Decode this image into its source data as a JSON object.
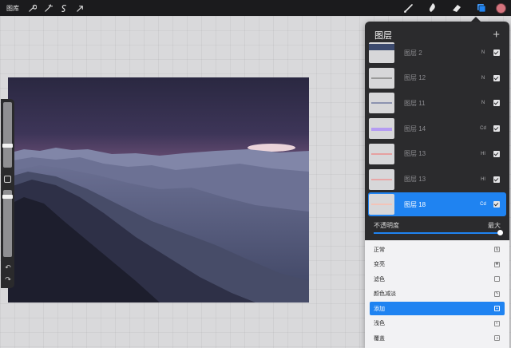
{
  "topbar": {
    "gallery_label": "图库",
    "left_tools": [
      "wrench-icon",
      "magic-wand-icon",
      "selection-icon",
      "move-arrow-icon"
    ],
    "right_tools": [
      "brush-icon",
      "smudge-icon",
      "eraser-icon",
      "layers-icon"
    ],
    "active_color": "#d5747e"
  },
  "layers_panel": {
    "title": "图层",
    "add_label": "+",
    "layers": [
      {
        "name": "图层 2",
        "blend": "N",
        "visible": true,
        "stroke_color": "#3c4a6e"
      },
      {
        "name": "图层 12",
        "blend": "N",
        "visible": true,
        "stroke_color": "#9a9a9a"
      },
      {
        "name": "图层 11",
        "blend": "N",
        "visible": true,
        "stroke_color": "#8c93b0"
      },
      {
        "name": "图层 14",
        "blend": "Cd",
        "visible": true,
        "stroke_color": "#b59cf2"
      },
      {
        "name": "图层 13",
        "blend": "Hl",
        "visible": true,
        "stroke_color": "#e6a0a0"
      },
      {
        "name": "图层 13",
        "blend": "Hl",
        "visible": true,
        "stroke_color": "#e8a7a7"
      },
      {
        "name": "图层 18",
        "blend": "Cd",
        "visible": true,
        "stroke_color": "#f3c4b8",
        "active": true
      }
    ],
    "opacity": {
      "label": "不透明度",
      "max_label": "最大",
      "value": 1.0
    },
    "blend_modes": [
      {
        "label": "正常",
        "icon": "n-icon"
      },
      {
        "label": "变亮",
        "icon": "sun-icon"
      },
      {
        "label": "滤色",
        "icon": "screen-icon"
      },
      {
        "label": "颜色减淡",
        "icon": "dodge-icon"
      },
      {
        "label": "添加",
        "icon": "plus-icon",
        "active": true
      },
      {
        "label": "浅色",
        "icon": "lighter-icon"
      },
      {
        "label": "覆盖",
        "icon": "overlay-icon"
      }
    ]
  },
  "colors": {
    "accent": "#1f83f1",
    "panel_bg": "#2b2b2d",
    "topbar_bg": "#1b1b1d"
  }
}
